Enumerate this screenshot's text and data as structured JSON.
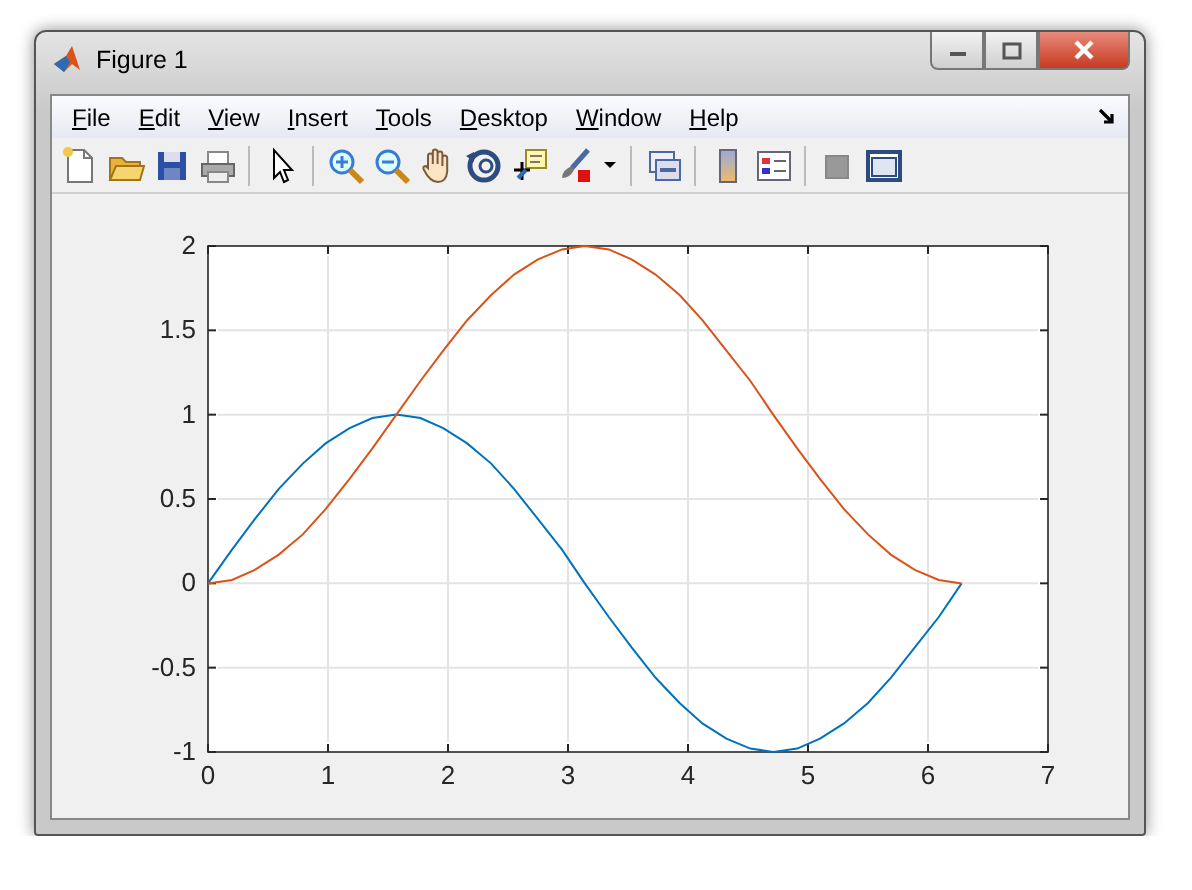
{
  "window": {
    "title": "Figure 1"
  },
  "menu": [
    "File",
    "Edit",
    "View",
    "Insert",
    "Tools",
    "Desktop",
    "Window",
    "Help"
  ],
  "toolbar": [
    {
      "kind": "new"
    },
    {
      "kind": "open"
    },
    {
      "kind": "save"
    },
    {
      "kind": "print"
    },
    {
      "kind": "sep"
    },
    {
      "kind": "pointer"
    },
    {
      "kind": "sep"
    },
    {
      "kind": "zoomin"
    },
    {
      "kind": "zoomout"
    },
    {
      "kind": "pan"
    },
    {
      "kind": "rotate"
    },
    {
      "kind": "cursor"
    },
    {
      "kind": "brush"
    },
    {
      "kind": "caret"
    },
    {
      "kind": "sep"
    },
    {
      "kind": "link"
    },
    {
      "kind": "sep"
    },
    {
      "kind": "colorbar"
    },
    {
      "kind": "legend"
    },
    {
      "kind": "sep"
    },
    {
      "kind": "hide"
    },
    {
      "kind": "show"
    }
  ],
  "chart_data": {
    "type": "line",
    "grid": true,
    "xlim": [
      0,
      7
    ],
    "ylim": [
      -1,
      2
    ],
    "xticks": [
      0,
      1,
      2,
      3,
      4,
      5,
      6,
      7
    ],
    "yticks": [
      -1,
      -0.5,
      0,
      0.5,
      1,
      1.5,
      2
    ],
    "x": [
      0,
      0.2,
      0.39,
      0.59,
      0.79,
      0.98,
      1.18,
      1.37,
      1.57,
      1.77,
      1.96,
      2.16,
      2.36,
      2.55,
      2.75,
      2.95,
      3.14,
      3.34,
      3.53,
      3.73,
      3.93,
      4.12,
      4.32,
      4.52,
      4.71,
      4.91,
      5.1,
      5.3,
      5.5,
      5.69,
      5.89,
      6.09,
      6.28
    ],
    "series": [
      {
        "color": "#0072bd",
        "values": [
          0,
          0.2,
          0.38,
          0.56,
          0.71,
          0.83,
          0.92,
          0.98,
          1,
          0.98,
          0.92,
          0.83,
          0.71,
          0.56,
          0.38,
          0.2,
          0,
          -0.2,
          -0.38,
          -0.56,
          -0.71,
          -0.83,
          -0.92,
          -0.98,
          -1,
          -0.98,
          -0.92,
          -0.83,
          -0.71,
          -0.56,
          -0.38,
          -0.2,
          0
        ]
      },
      {
        "color": "#d95319",
        "values": [
          0,
          0.02,
          0.08,
          0.17,
          0.29,
          0.44,
          0.62,
          0.8,
          1,
          1.2,
          1.38,
          1.56,
          1.71,
          1.83,
          1.92,
          1.98,
          2,
          1.98,
          1.92,
          1.83,
          1.71,
          1.56,
          1.38,
          1.2,
          1,
          0.8,
          0.62,
          0.44,
          0.29,
          0.17,
          0.08,
          0.02,
          0
        ]
      }
    ]
  }
}
